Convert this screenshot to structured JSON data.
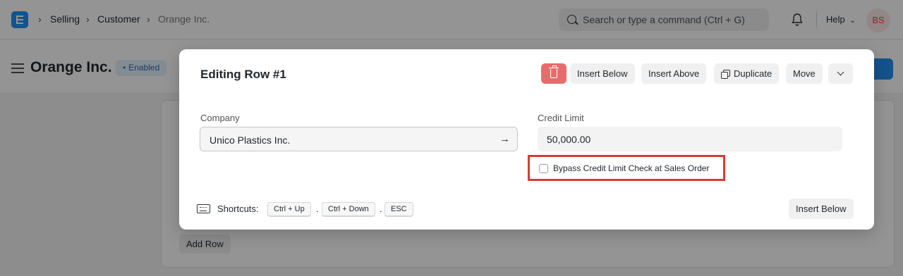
{
  "navbar": {
    "breadcrumbs": [
      "Selling",
      "Customer",
      "Orange Inc."
    ],
    "search_placeholder": "Search or type a command (Ctrl + G)",
    "help_label": "Help",
    "avatar_initials": "BS"
  },
  "page": {
    "title": "Orange Inc.",
    "status": "Enabled",
    "add_row_label": "Add Row"
  },
  "modal": {
    "title": "Editing Row #1",
    "actions": {
      "insert_below": "Insert Below",
      "insert_above": "Insert Above",
      "duplicate": "Duplicate",
      "move": "Move"
    },
    "fields": {
      "company_label": "Company",
      "company_value": "Unico Plastics Inc.",
      "credit_limit_label": "Credit Limit",
      "credit_limit_value": "50,000.00",
      "bypass_label": "Bypass Credit Limit Check at Sales Order",
      "bypass_checked": false
    },
    "shortcuts": {
      "label": "Shortcuts:",
      "keys": [
        "Ctrl + Up",
        "Ctrl + Down",
        "ESC"
      ],
      "separator": "."
    },
    "footer_button": "Insert Below"
  },
  "colors": {
    "primary": "#2490ef",
    "danger": "#e86c6c",
    "highlight_box": "#d93a34"
  }
}
